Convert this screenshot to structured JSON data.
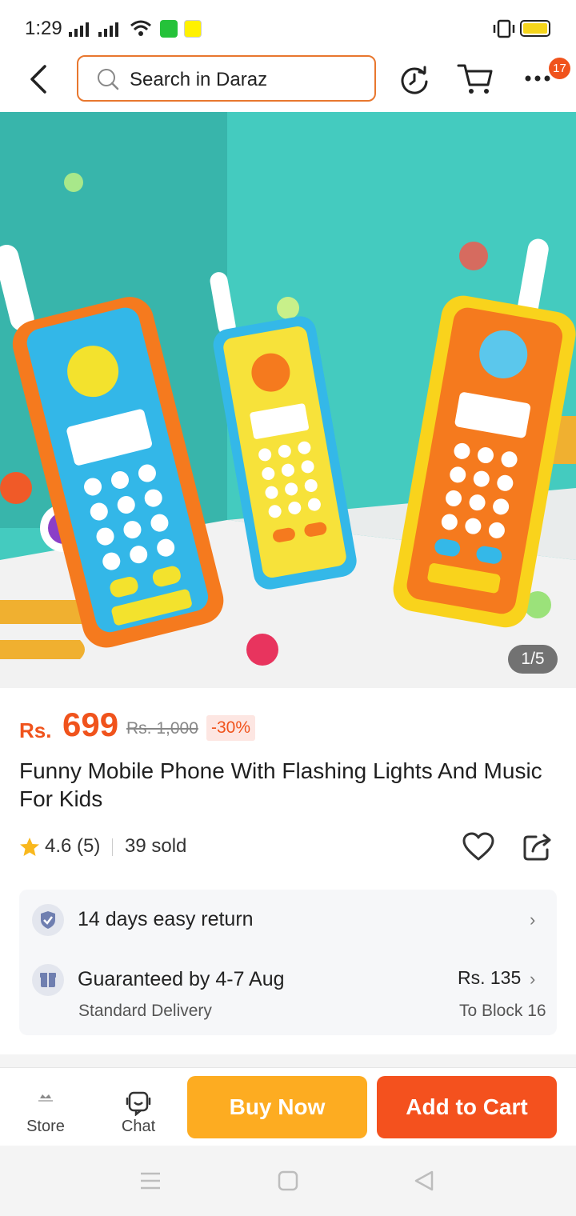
{
  "status_bar": {
    "time": "1:29"
  },
  "search": {
    "placeholder": "Search in Daraz"
  },
  "header": {
    "badge_count": "17"
  },
  "gallery": {
    "counter": "1/5"
  },
  "product": {
    "currency": "Rs.",
    "price": "699",
    "original_price": "Rs. 1,000",
    "discount": "-30%",
    "title": "Funny Mobile Phone With Flashing Lights And Music For Kids",
    "rating": "4.6 (5)",
    "sold": "39 sold"
  },
  "services": {
    "return_text": "14 days easy return",
    "delivery_text": "Guaranteed by 4-7 Aug",
    "delivery_type": "Standard Delivery",
    "delivery_fee": "Rs. 135",
    "delivery_location": "To Block 16"
  },
  "actions": {
    "store_label": "Store",
    "chat_label": "Chat",
    "buy_now": "Buy Now",
    "add_to_cart": "Add to Cart"
  },
  "colors": {
    "brand_orange": "#f0531c",
    "buy_now_bg": "#fdac21",
    "add_to_cart_bg": "#f4511e",
    "search_border": "#e8772e"
  }
}
